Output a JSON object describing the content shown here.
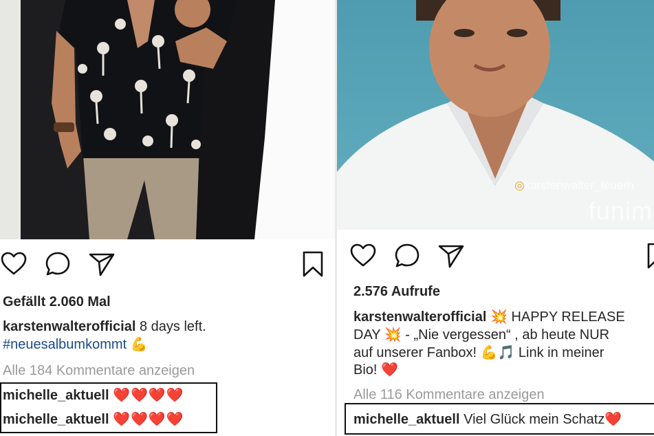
{
  "posts": [
    {
      "likes_text": "Gefällt 2.060 Mal",
      "caption_user": "karstenwalterofficial",
      "caption_text": " 8 days left.",
      "caption_hashtag": "#neuesalbumkommt",
      "caption_emoji": "💪",
      "view_comments": "Alle 184 Kommentare anzeigen",
      "comments": [
        {
          "user": "michelle_aktuell",
          "text": "❤️❤️❤️❤️"
        },
        {
          "user": "michelle_aktuell",
          "text": "❤️❤️❤️❤️"
        }
      ]
    },
    {
      "views_text": "2.576 Aufrufe",
      "caption_user": "karstenwalterofficial",
      "caption_line1": " 💥 HAPPY RELEASE",
      "caption_line2": "DAY 💥 - „Nie vergessen“ , ab heute NUR",
      "caption_line3": "auf unserer Fanbox! 💪🎵 Link in meiner",
      "caption_line4": "Bio! ❤️",
      "view_comments": "Alle 116 Kommentare anzeigen",
      "comments": [
        {
          "user": "michelle_aktuell",
          "text": " Viel Glück mein Schatz❤️"
        }
      ],
      "watermark_handle": "karstenwalter_feuerh",
      "watermark_brand": "funima"
    }
  ],
  "icons": [
    "heart-icon",
    "comment-icon",
    "share-icon",
    "bookmark-icon"
  ],
  "colors": {
    "heart_red": "#e0242c",
    "hashtag_blue": "#1a4a8c",
    "muted_gray": "#9a9a9a"
  }
}
